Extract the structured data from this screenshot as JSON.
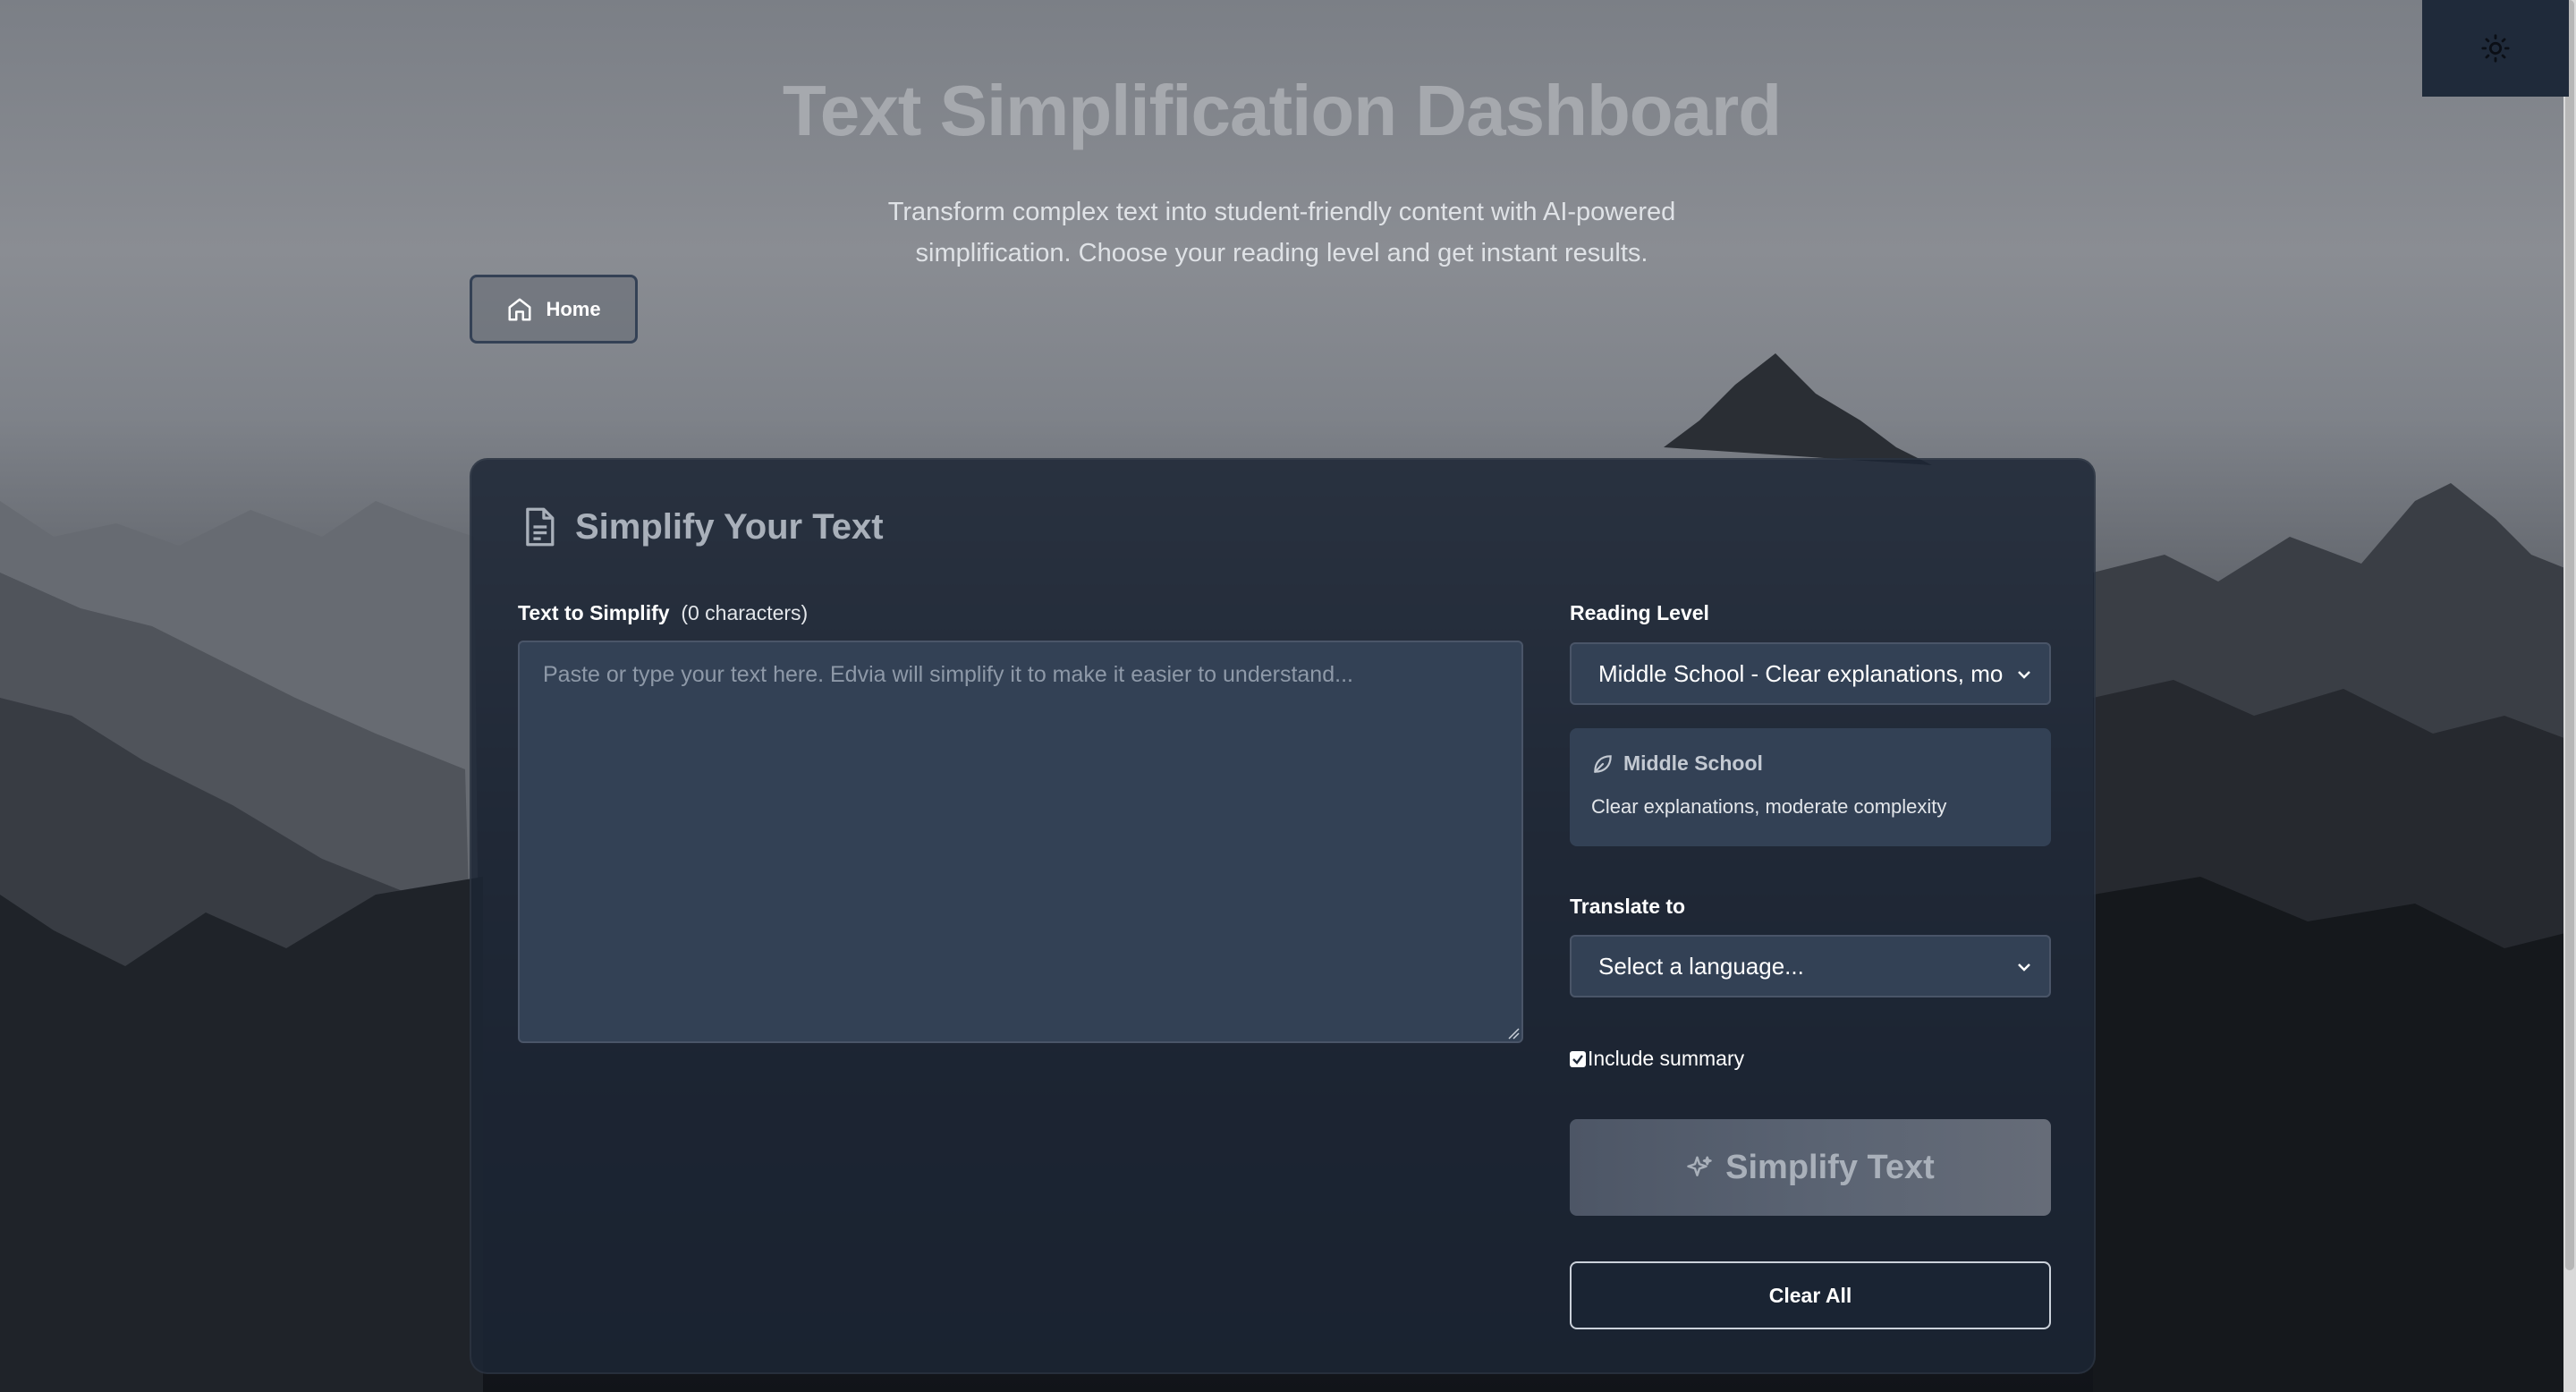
{
  "header": {
    "title": "Text Simplification Dashboard",
    "subtitle": "Transform complex text into student-friendly content with AI-powered simplification. Choose your reading level and get instant results."
  },
  "nav": {
    "home_label": "Home"
  },
  "theme_toggle": {
    "icon": "sun-icon"
  },
  "panel": {
    "title": "Simplify Your Text",
    "text_label": "Text to Simplify",
    "char_count": "(0 characters)",
    "text_placeholder": "Paste or type your text here. Edvia will simplify it to make it easier to understand...",
    "text_value": "",
    "reading_level": {
      "label": "Reading Level",
      "selected": "Middle School - Clear explanations, mo",
      "card_title": "Middle School",
      "card_desc": "Clear explanations, moderate complexity"
    },
    "translate": {
      "label": "Translate to",
      "selected": "Select a language..."
    },
    "include_summary": {
      "label": "Include summary",
      "checked": true
    },
    "simplify_label": "Simplify Text",
    "clear_label": "Clear All"
  },
  "colors": {
    "panel_bg": "#1c2534",
    "input_bg": "#334155",
    "accent_text": "#a9b0ba"
  }
}
